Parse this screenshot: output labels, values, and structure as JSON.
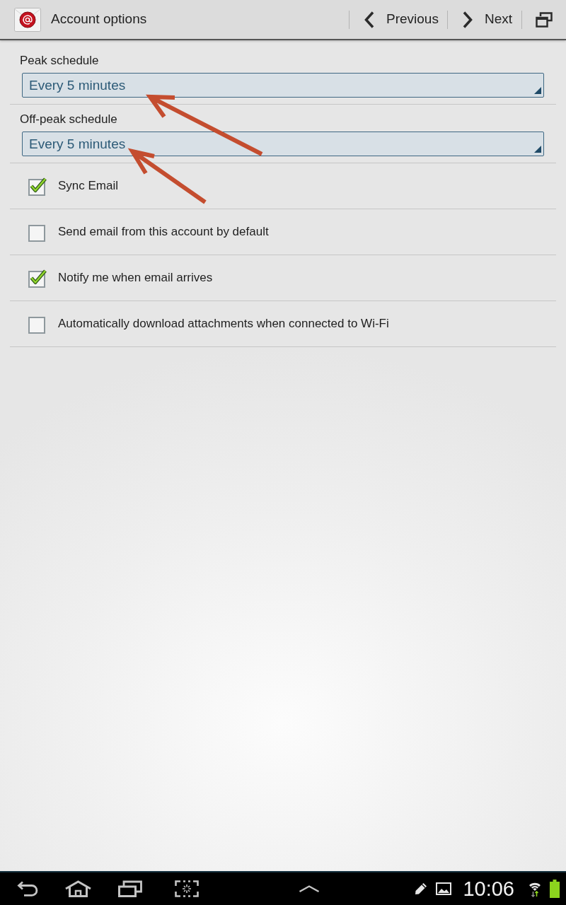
{
  "action_bar": {
    "title": "Account options",
    "buttons": [
      {
        "kind": "previous",
        "label": "Previous"
      },
      {
        "kind": "next",
        "label": "Next"
      }
    ]
  },
  "schedules": [
    {
      "label": "Peak schedule",
      "value": "Every 5 minutes"
    },
    {
      "label": "Off-peak schedule",
      "value": "Every 5 minutes"
    }
  ],
  "options": [
    {
      "label": "Sync Email",
      "checked": true
    },
    {
      "label": "Send email from this account by default",
      "checked": false
    },
    {
      "label": "Notify me when email arrives",
      "checked": true
    },
    {
      "label": "Automatically download attachments when connected to Wi-Fi",
      "checked": false
    }
  ],
  "annotations": [
    {
      "kind": "arrow"
    },
    {
      "kind": "arrow"
    }
  ],
  "status_bar": {
    "time": "10:06"
  }
}
